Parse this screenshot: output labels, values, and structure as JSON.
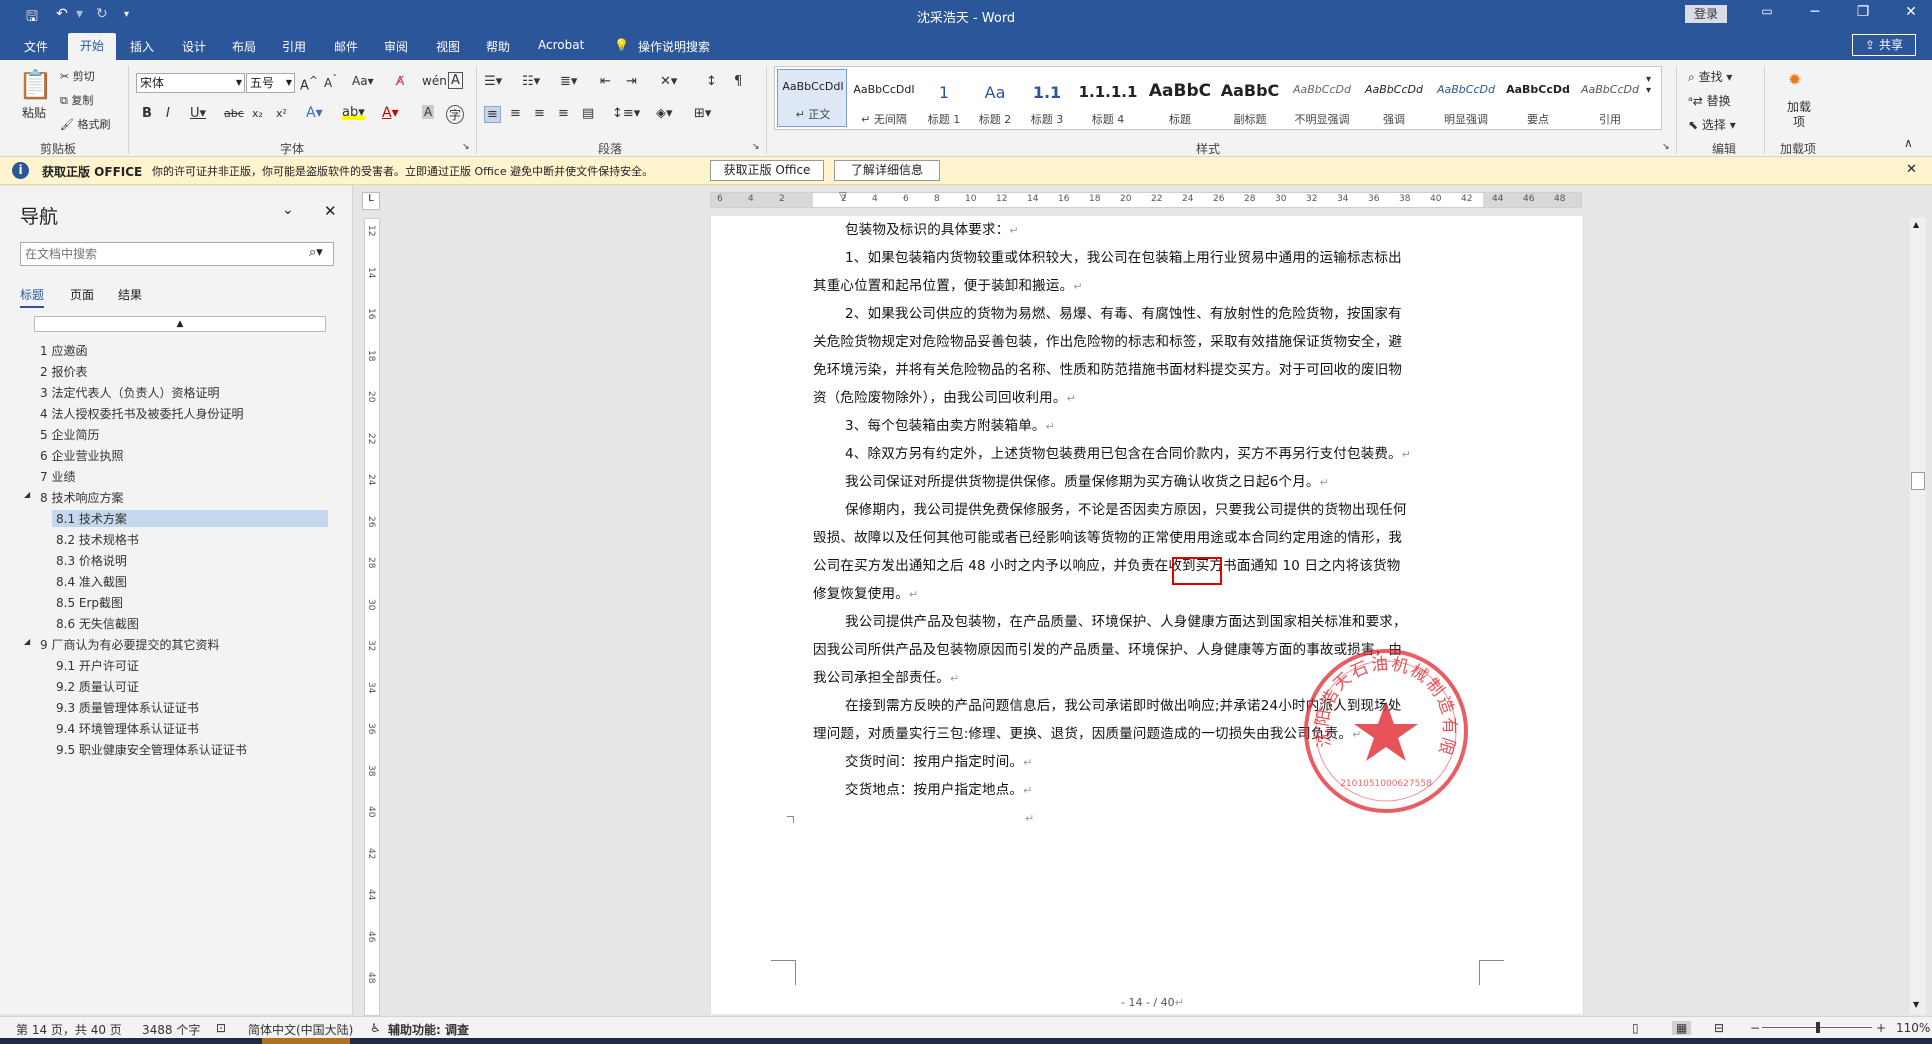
{
  "window": {
    "title": "沈采浩天 - Word",
    "login": "登录",
    "share": "共享",
    "tell_me": "操作说明搜索"
  },
  "tabs": [
    "文件",
    "开始",
    "插入",
    "设计",
    "布局",
    "引用",
    "邮件",
    "审阅",
    "视图",
    "帮助",
    "Acrobat"
  ],
  "ribbon": {
    "clipboard": {
      "paste": "粘贴",
      "cut": "剪切",
      "copy": "复制",
      "format_painter": "格式刷",
      "label": "剪贴板"
    },
    "font": {
      "name": "宋体",
      "size": "五号",
      "label": "字体"
    },
    "paragraph": {
      "label": "段落"
    },
    "styles": {
      "label": "样式",
      "items": [
        {
          "preview": "AaBbCcDdI",
          "name": "↵ 正文"
        },
        {
          "preview": "AaBbCcDdI",
          "name": "↵ 无间隔"
        },
        {
          "preview": "1",
          "name": "标题 1"
        },
        {
          "preview": "Aa",
          "name": "标题 2"
        },
        {
          "preview": "1.1",
          "name": "标题 3"
        },
        {
          "preview": "1.1.1.1",
          "name": "标题 4"
        },
        {
          "preview": "AaBbC",
          "name": "标题"
        },
        {
          "preview": "AaBbC",
          "name": "副标题"
        },
        {
          "preview": "AaBbCcDd",
          "name": "不明显强调"
        },
        {
          "preview": "AaBbCcDd",
          "name": "强调"
        },
        {
          "preview": "AaBbCcDd",
          "name": "明显强调"
        },
        {
          "preview": "AaBbCcDd",
          "name": "要点"
        },
        {
          "preview": "AaBbCcDd",
          "name": "引用"
        }
      ]
    },
    "editing": {
      "find": "查找",
      "replace": "替换",
      "select": "选择",
      "label": "编辑"
    },
    "addins": {
      "button": "加载项",
      "label": "加载项"
    }
  },
  "infobar": {
    "title": "获取正版 OFFICE",
    "message": "你的许可证并非正版，你可能是盗版软件的受害者。立即通过正版 Office 避免中断并使文件保持安全。",
    "btn1": "获取正版 Office",
    "btn2": "了解详细信息"
  },
  "nav": {
    "title": "导航",
    "search_placeholder": "在文档中搜索",
    "tabs": [
      "标题",
      "页面",
      "结果"
    ],
    "items": [
      {
        "text": "1 应邀函",
        "level": 1
      },
      {
        "text": "2 报价表",
        "level": 1
      },
      {
        "text": "3 法定代表人（负责人）资格证明",
        "level": 1
      },
      {
        "text": "4 法人授权委托书及被委托人身份证明",
        "level": 1
      },
      {
        "text": "5 企业简历",
        "level": 1
      },
      {
        "text": "6 企业营业执照",
        "level": 1
      },
      {
        "text": "7 业绩",
        "level": 1
      },
      {
        "text": "8 技术响应方案",
        "level": 1
      },
      {
        "text": "8.1 技术方案",
        "level": 2
      },
      {
        "text": "8.2 技术规格书",
        "level": 2
      },
      {
        "text": "8.3 价格说明",
        "level": 2
      },
      {
        "text": "8.4 准入截图",
        "level": 2
      },
      {
        "text": "8.5 Erp截图",
        "level": 2
      },
      {
        "text": "8.6 无失信截图",
        "level": 2
      },
      {
        "text": "9 厂商认为有必要提交的其它资料",
        "level": 1
      },
      {
        "text": "9.1 开户许可证",
        "level": 2
      },
      {
        "text": "9.2 质量认可证",
        "level": 2
      },
      {
        "text": "9.3 质量管理体系认证证书",
        "level": 2
      },
      {
        "text": "9.4 环境管理体系认证证书",
        "level": 2
      },
      {
        "text": "9.5 职业健康安全管理体系认证证书",
        "level": 2
      }
    ]
  },
  "document": {
    "lines": [
      "包装物及标识的具体要求：",
      "1、如果包装箱内货物较重或体积较大，我公司在包装箱上用行业贸易中通用的运输标志标出",
      "其重心位置和起吊位置，便于装卸和搬运。",
      "2、如果我公司供应的货物为易燃、易爆、有毒、有腐蚀性、有放射性的危险货物，按国家有",
      "关危险货物规定对危险物品妥善包装，作出危险物的标志和标签，采取有效措施保证货物安全，避",
      "免环境污染，并将有关危险物品的名称、性质和防范措施书面材料提交买方。对于可回收的废旧物",
      "资（危险废物除外），由我公司回收利用。",
      "3、每个包装箱由卖方附装箱单。",
      "4、除双方另有约定外，上述货物包装费用已包含在合同价款内，买方不再另行支付包装费。",
      "我公司保证对所提供货物提供保修。质量保修期为买方确认收货之日起6个月。",
      "保修期内，我公司提供免费保修服务，不论是否因卖方原因，只要我公司提供的货物出现任何",
      "毁损、故障以及任何其他可能或者已经影响该等货物的正常使用用途或本合同约定用途的情形，我",
      "公司在买方发出通知之后 48 小时之内予以响应，并负责在收到买方书面通知 10 日之内将该货物",
      "修复恢复使用。",
      "我公司提供产品及包装物，在产品质量、环境保护、人身健康方面达到国家相关标准和要求，",
      "因我公司所供产品及包装物原因而引发的产品质量、环境保护、人身健康等方面的事故或损害，由",
      "我公司承担全部责任。",
      "在接到需方反映的产品问题信息后，我公司承诺即时做出响应;并承诺24小时内派人到现场处",
      "理问题，对质量实行三包:修理、更换、退货，因质量问题造成的一切损失由我公司负责。",
      "交货时间：按用户指定时间。",
      "交货地点：按用户指定地点。"
    ],
    "footer": "- 14 -  /  40",
    "stamp_text": "沈阳浩天石油机械制造有限公司",
    "stamp_number": "2101051000627558"
  },
  "status": {
    "page": "第 14 页，共 40 页",
    "words": "3488 个字",
    "language": "简体中文(中国大陆)",
    "accessibility": "辅助功能: 调查",
    "zoom": "110%"
  }
}
